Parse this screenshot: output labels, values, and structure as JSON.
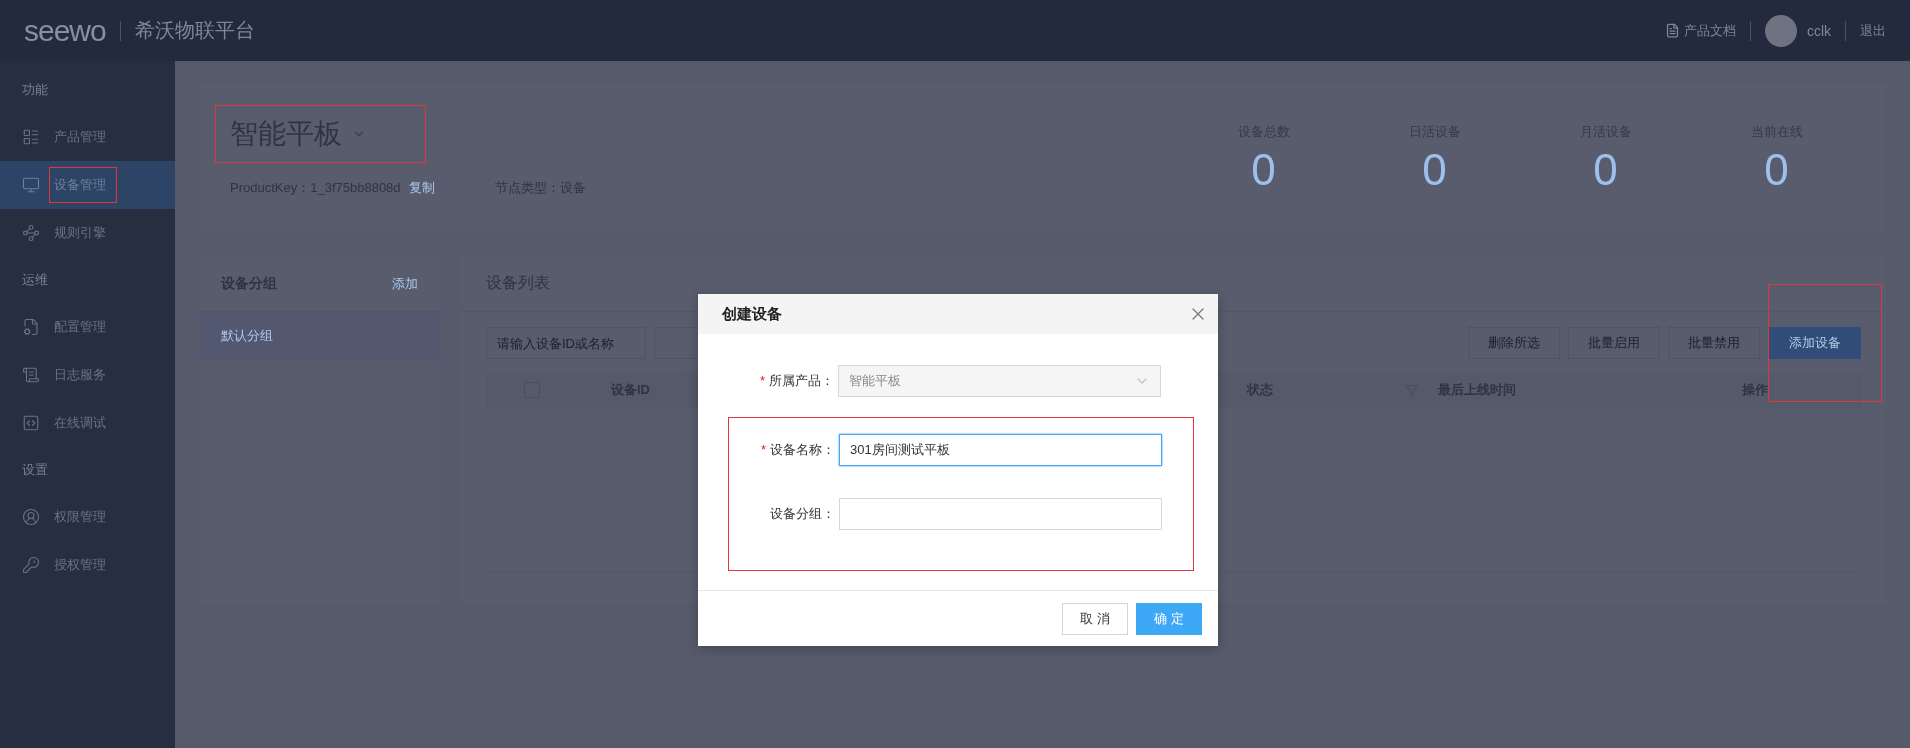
{
  "header": {
    "logo": "seewo",
    "title": "希沃物联平台",
    "docs_link": "产品文档",
    "username": "cclk",
    "logout": "退出"
  },
  "sidebar": {
    "sections": [
      {
        "heading": "功能",
        "items": [
          {
            "label": "产品管理",
            "selected": false,
            "highlighted": false
          },
          {
            "label": "设备管理",
            "selected": true,
            "highlighted": true
          },
          {
            "label": "规则引擎",
            "selected": false,
            "highlighted": false
          }
        ]
      },
      {
        "heading": "运维",
        "items": [
          {
            "label": "配置管理",
            "selected": false,
            "highlighted": false
          },
          {
            "label": "日志服务",
            "selected": false,
            "highlighted": false
          },
          {
            "label": "在线调试",
            "selected": false,
            "highlighted": false
          }
        ]
      },
      {
        "heading": "设置",
        "items": [
          {
            "label": "权限管理",
            "selected": false,
            "highlighted": false
          },
          {
            "label": "授权管理",
            "selected": false,
            "highlighted": false
          }
        ]
      }
    ]
  },
  "product": {
    "name": "智能平板",
    "highlighted": true,
    "product_key": "ProductKey：1_3f75bb8808d",
    "copy_link": "复制",
    "node_type": "节点类型：设备",
    "stats": [
      {
        "label": "设备总数",
        "value": "0"
      },
      {
        "label": "日活设备",
        "value": "0"
      },
      {
        "label": "月活设备",
        "value": "0"
      },
      {
        "label": "当前在线",
        "value": "0"
      }
    ]
  },
  "groups": {
    "title": "设备分组",
    "add_link": "添加",
    "items": [
      {
        "label": "默认分组",
        "selected": true
      }
    ]
  },
  "device_list": {
    "title": "设备列表",
    "search": {
      "placeholder": "请输入设备ID或名称"
    },
    "buttons": [
      {
        "label": "删除所选",
        "kind": "outline",
        "highlighted": false
      },
      {
        "label": "批量启用",
        "kind": "outline",
        "highlighted": false
      },
      {
        "label": "批量禁用",
        "kind": "outline",
        "highlighted": false
      },
      {
        "label": "添加设备",
        "kind": "primary",
        "highlighted": true
      }
    ],
    "select_all": {
      "checked": false
    },
    "columns": [
      {
        "label": "设备ID",
        "filter": false
      },
      {
        "label": "状态",
        "filter": true
      },
      {
        "label": "最后上线时间",
        "filter": false
      },
      {
        "label": "操作",
        "filter": false
      }
    ]
  },
  "modal": {
    "title": "创建设备",
    "fields": [
      {
        "label": "所属产品：",
        "marker": "*",
        "kind": "select",
        "value": "智能平板",
        "disabled": true,
        "focused": false,
        "highlighted": false
      },
      {
        "label": "设备名称：",
        "marker": "*",
        "kind": "text",
        "value": "301房间测试平板",
        "disabled": false,
        "focused": true,
        "highlighted": true
      },
      {
        "label": "设备分组：",
        "kind": "text",
        "disabled": false,
        "focused": false,
        "highlighted": true
      }
    ],
    "buttons": [
      {
        "label": "取 消",
        "kind": "default"
      },
      {
        "label": "确 定",
        "kind": "primary"
      }
    ]
  }
}
